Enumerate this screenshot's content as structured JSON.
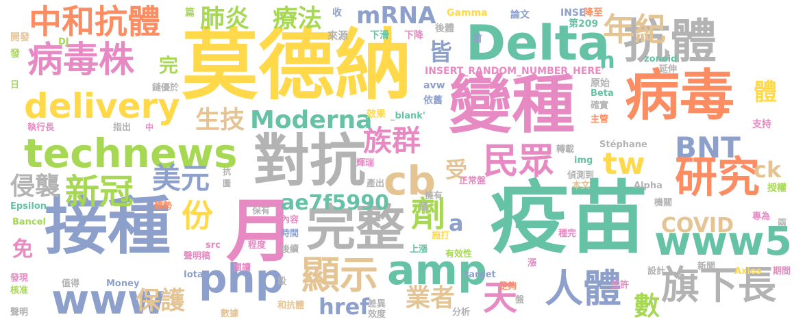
{
  "palette": {
    "yellow": "#ffd94a",
    "green": "#66c2a5",
    "blue": "#8da0cb",
    "pink": "#e78ac3",
    "lime": "#a6d854",
    "gray": "#b3b3b3",
    "tan": "#e5c494",
    "orange": "#fc8d62"
  },
  "words": [
    {
      "text": "莫德納",
      "color": "yellow"
    },
    {
      "text": "疫苗",
      "color": "green"
    },
    {
      "text": "接種",
      "color": "blue"
    },
    {
      "text": "變種",
      "color": "pink"
    },
    {
      "text": "病毒",
      "color": "orange"
    },
    {
      "text": "Delta",
      "color": "green"
    },
    {
      "text": "抗體",
      "color": "gray"
    },
    {
      "text": "對抗",
      "color": "gray"
    },
    {
      "text": "月",
      "color": "pink"
    },
    {
      "text": "完整",
      "color": "gray"
    },
    {
      "text": "technews",
      "color": "lime"
    },
    {
      "text": "delivery",
      "color": "yellow"
    },
    {
      "text": "病毒株",
      "color": "pink"
    },
    {
      "text": "中和抗體",
      "color": "orange"
    },
    {
      "text": "www",
      "color": "blue"
    },
    {
      "text": "php",
      "color": "blue"
    },
    {
      "text": "amp",
      "color": "green"
    },
    {
      "text": "cb",
      "color": "tan"
    },
    {
      "text": "研究",
      "color": "orange"
    },
    {
      "text": "民眾",
      "color": "pink"
    },
    {
      "text": "www5",
      "color": "green"
    },
    {
      "text": "人體",
      "color": "blue"
    },
    {
      "text": "旗下長",
      "color": "gray"
    },
    {
      "text": "顯示",
      "color": "tan"
    },
    {
      "text": "新冠",
      "color": "lime"
    },
    {
      "text": "tw",
      "color": "yellow"
    },
    {
      "text": "BNT",
      "color": "blue"
    },
    {
      "text": "年紀",
      "color": "tan"
    },
    {
      "text": "族群",
      "color": "pink"
    },
    {
      "text": "Moderna",
      "color": "green"
    },
    {
      "text": "mRNA",
      "color": "blue"
    },
    {
      "text": "美元",
      "color": "blue"
    },
    {
      "text": "生技",
      "color": "tan"
    },
    {
      "text": "療法",
      "color": "lime"
    },
    {
      "text": "肺炎",
      "color": "lime"
    },
    {
      "text": "份",
      "color": "yellow"
    },
    {
      "text": "劑",
      "color": "lime"
    },
    {
      "text": "天",
      "color": "pink"
    },
    {
      "text": "保護",
      "color": "tan"
    },
    {
      "text": "業者",
      "color": "tan"
    },
    {
      "text": "侵襲",
      "color": "gray"
    },
    {
      "text": "ae7f5990",
      "color": "green"
    },
    {
      "text": "href",
      "color": "blue"
    },
    {
      "text": "數",
      "color": "lime"
    },
    {
      "text": "COVID",
      "color": "tan"
    },
    {
      "text": "ck",
      "color": "tan"
    },
    {
      "text": "體",
      "color": "yellow"
    },
    {
      "text": "皆",
      "color": "blue"
    },
    {
      "text": "n",
      "color": "green"
    },
    {
      "text": "受",
      "color": "tan"
    },
    {
      "text": "a",
      "color": "blue"
    },
    {
      "text": "完",
      "color": "lime"
    },
    {
      "text": "免",
      "color": "pink"
    },
    {
      "text": "篇",
      "color": "lime"
    },
    {
      "text": "收",
      "color": "blue"
    },
    {
      "text": "來源",
      "color": "gray"
    },
    {
      "text": "開發",
      "color": "tan"
    },
    {
      "text": "DJ",
      "color": "lime"
    },
    {
      "text": "發",
      "color": "lime"
    },
    {
      "text": "日",
      "color": "lime"
    },
    {
      "text": "Gamma",
      "color": "yellow"
    },
    {
      "text": "論文",
      "color": "blue"
    },
    {
      "text": "INSE",
      "color": "blue"
    },
    {
      "text": "降至",
      "color": "orange"
    },
    {
      "text": "第209",
      "color": "green"
    },
    {
      "text": "下滑",
      "color": "green"
    },
    {
      "text": "下降",
      "color": "pink"
    },
    {
      "text": "後體",
      "color": "gray"
    },
    {
      "text": "首",
      "color": "blue"
    },
    {
      "text": "zoneid",
      "color": "green"
    },
    {
      "text": "延伸",
      "color": "gray"
    },
    {
      "text": "INSERT_RANDOM_NUMBER_HERE'",
      "color": "pink"
    },
    {
      "text": "原始",
      "color": "gray"
    },
    {
      "text": "avw",
      "color": "blue"
    },
    {
      "text": "Beta",
      "color": "green"
    },
    {
      "text": "確實",
      "color": "gray"
    },
    {
      "text": "鏈優於",
      "color": "gray"
    },
    {
      "text": "效果",
      "color": "yellow"
    },
    {
      "text": "_blank'",
      "color": "green"
    },
    {
      "text": "依舊",
      "color": "blue"
    },
    {
      "text": "主管",
      "color": "orange"
    },
    {
      "text": "支持",
      "color": "pink"
    },
    {
      "text": "執行長",
      "color": "pink"
    },
    {
      "text": "指出",
      "color": "gray"
    },
    {
      "text": "中",
      "color": "pink"
    },
    {
      "text": "轉載",
      "color": "gray"
    },
    {
      "text": "Stéphane",
      "color": "gray"
    },
    {
      "text": "img",
      "color": "green"
    },
    {
      "text": "偵測到",
      "color": "gray"
    },
    {
      "text": "輝瑞",
      "color": "pink"
    },
    {
      "text": "抗",
      "color": "gray"
    },
    {
      "text": "圖",
      "color": "gray"
    },
    {
      "text": "產出",
      "color": "gray"
    },
    {
      "text": "正常盤",
      "color": "pink"
    },
    {
      "text": "本文",
      "color": "tan"
    },
    {
      "text": "授權",
      "color": "lime"
    },
    {
      "text": "Alpha",
      "color": "gray"
    },
    {
      "text": "機關",
      "color": "gray"
    },
    {
      "text": "Epsilon",
      "color": "green"
    },
    {
      "text": "趨勢",
      "color": "orange"
    },
    {
      "text": "保有",
      "color": "gray"
    },
    {
      "text": "擁有",
      "color": "gray"
    },
    {
      "text": "僅",
      "color": "gray"
    },
    {
      "text": "專為",
      "color": "pink"
    },
    {
      "text": "Bancel",
      "color": "lime"
    },
    {
      "text": "內容",
      "color": "pink"
    },
    {
      "text": "兩",
      "color": "gray"
    },
    {
      "text": "src",
      "color": "pink"
    },
    {
      "text": "時間",
      "color": "blue"
    },
    {
      "text": "施打",
      "color": "yellow"
    },
    {
      "text": "種完",
      "color": "pink"
    },
    {
      "text": "程度",
      "color": "pink"
    },
    {
      "text": "上漲",
      "color": "green"
    },
    {
      "text": "聲明稿",
      "color": "pink"
    },
    {
      "text": "後續",
      "color": "gray"
    },
    {
      "text": "有效性",
      "color": "lime"
    },
    {
      "text": "閱讀",
      "color": "pink"
    },
    {
      "text": "漲",
      "color": "pink"
    },
    {
      "text": "設計",
      "color": "gray"
    },
    {
      "text": "新聞",
      "color": "gray"
    },
    {
      "text": "Axios",
      "color": "yellow"
    },
    {
      "text": "期間",
      "color": "pink"
    },
    {
      "text": "發現",
      "color": "pink"
    },
    {
      "text": "值得",
      "color": "gray"
    },
    {
      "text": "Money",
      "color": "blue"
    },
    {
      "text": "Iota",
      "color": "blue"
    },
    {
      "text": "target",
      "color": "blue"
    },
    {
      "text": "足夠",
      "color": "orange"
    },
    {
      "text": "些許",
      "color": "pink"
    },
    {
      "text": "核准",
      "color": "lime"
    },
    {
      "text": "段",
      "color": "gray"
    },
    {
      "text": "盤",
      "color": "gray"
    },
    {
      "text": "聲明",
      "color": "gray"
    },
    {
      "text": "數據",
      "color": "tan"
    },
    {
      "text": "和抗體",
      "color": "tan"
    },
    {
      "text": "差異",
      "color": "gray"
    },
    {
      "text": "效度",
      "color": "gray"
    },
    {
      "text": "分析",
      "color": "gray"
    }
  ]
}
